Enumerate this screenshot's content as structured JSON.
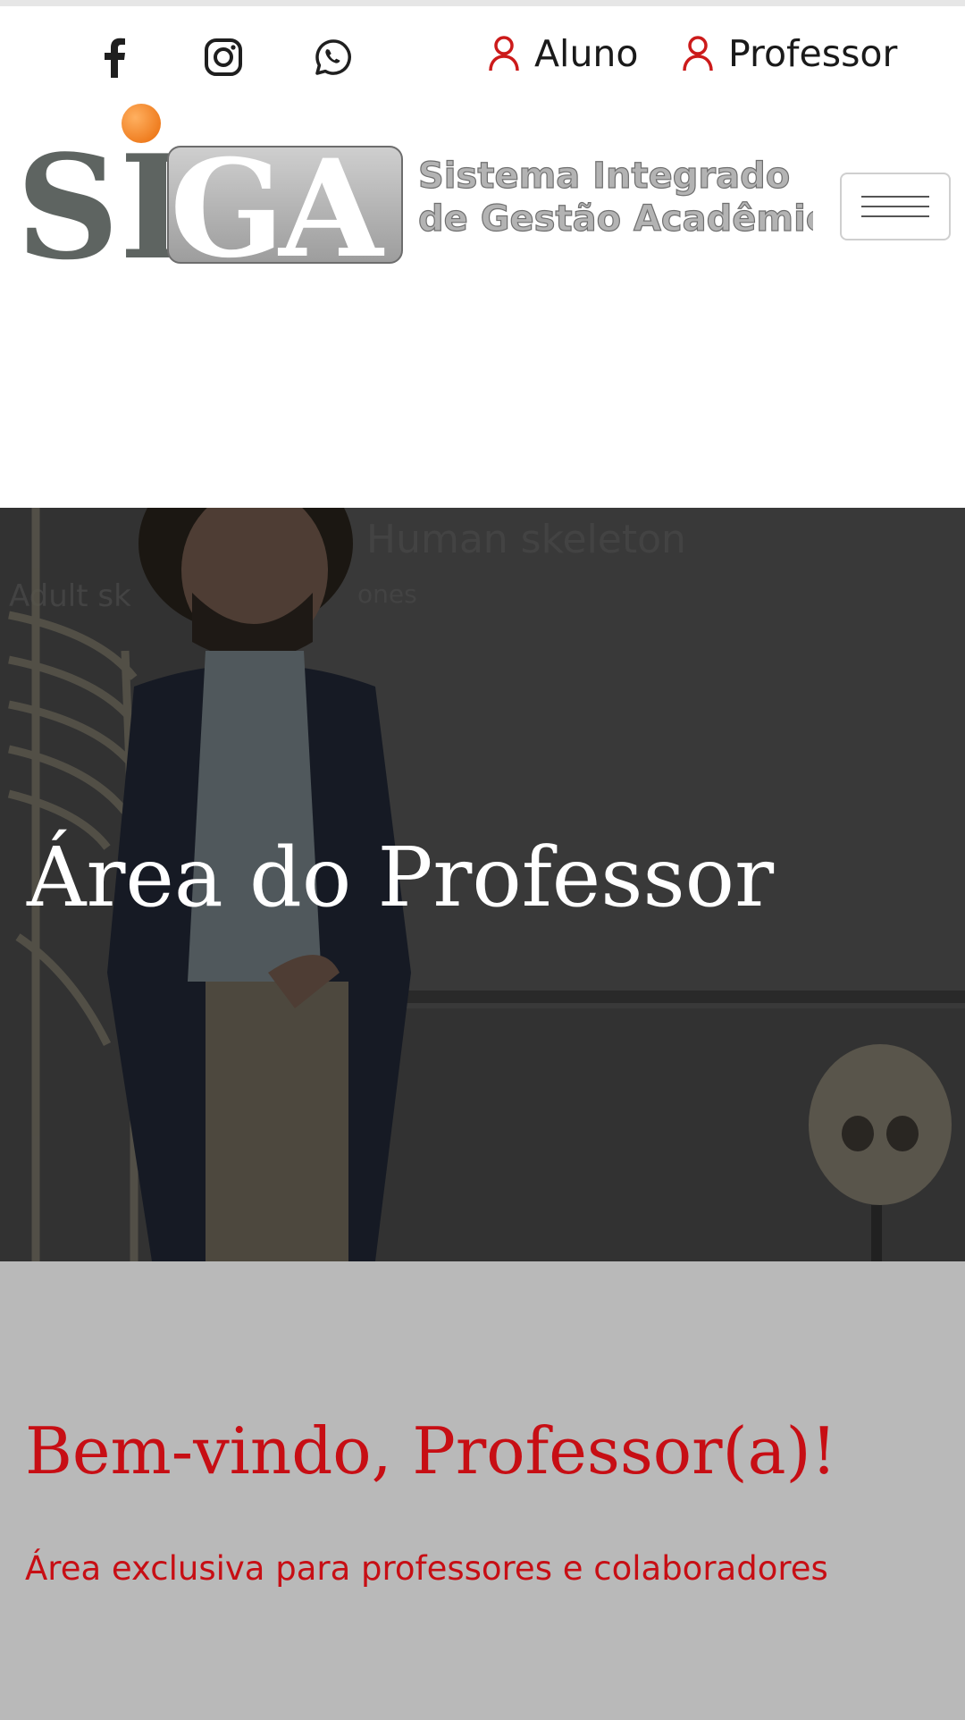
{
  "header": {
    "social": [
      {
        "icon": "facebook-icon"
      },
      {
        "icon": "instagram-icon"
      },
      {
        "icon": "whatsapp-icon"
      }
    ],
    "login_links": [
      {
        "label": "Aluno",
        "icon": "user-icon"
      },
      {
        "label": "Professor",
        "icon": "user-icon"
      }
    ],
    "logo": {
      "letters": "SIGA",
      "line1": "Sistema Integrado",
      "line2": "de Gestão Acadêmica"
    },
    "menu_icon": "hamburger-icon"
  },
  "hero": {
    "title": "Área do Professor",
    "board_text_1": "Human skeleton",
    "board_text_2": "Adult sk",
    "board_text_3": "ones"
  },
  "welcome": {
    "title": "Bem-vindo, Professor(a)!",
    "subtitle": "Área exclusiva para professores e colaboradores"
  },
  "colors": {
    "accent_red": "#c70e14",
    "welcome_bg": "#b9b9b9",
    "logo_orange": "#f28a2e",
    "logo_gray": "#5e6461"
  }
}
